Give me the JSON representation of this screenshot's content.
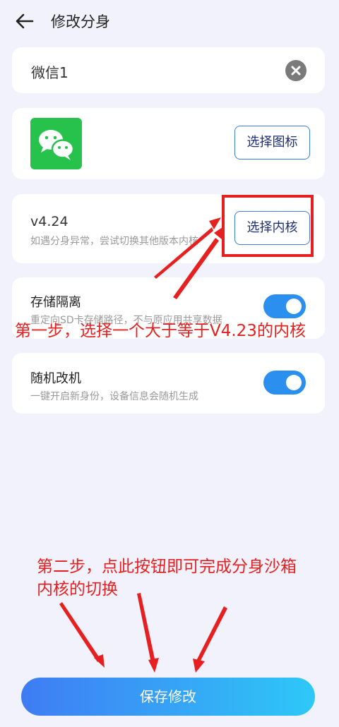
{
  "header": {
    "title": "修改分身",
    "back_icon": "arrow-left-icon"
  },
  "name_field": {
    "value": "微信1",
    "clear_icon": "clear-icon"
  },
  "icon_card": {
    "icon": "wechat-icon",
    "button_label": "选择图标"
  },
  "kernel_card": {
    "version": "v4.24",
    "hint": "如遇分身异常，尝试切换其他版本内核",
    "button_label": "选择内核"
  },
  "storage": {
    "label": "存储隔离",
    "description": "重定向SD卡存储路径，不与原应用共享数据",
    "enabled": true
  },
  "random_device": {
    "label": "随机改机",
    "description": "一键开启新身份，设备信息会随机生成",
    "enabled": true
  },
  "save_button": {
    "label": "保存修改"
  },
  "annotations": {
    "step1": "第一步，选择一个大于等于V4.23的内核",
    "step2_line1": "第二步，点此按钮即可完成分身沙箱",
    "step2_line2": "内核的切换"
  },
  "colors": {
    "accent": "#2b8ff0",
    "annotation_red": "#e62020",
    "background": "#f1f2fb",
    "wechat_green": "#27c24c"
  }
}
